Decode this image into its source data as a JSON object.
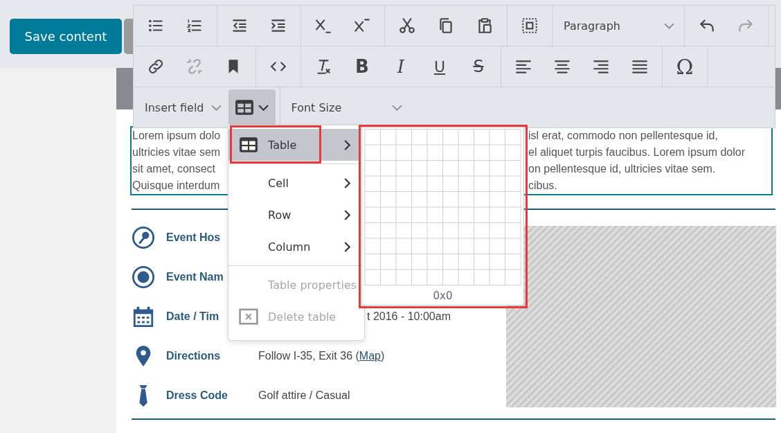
{
  "header": {
    "save_button": "Save content"
  },
  "toolbar": {
    "rows": [
      [
        {
          "buttons": [
            {
              "kind": "icon",
              "disabled": false
            },
            {
              "kind": "icon",
              "disabled": false
            }
          ]
        },
        {
          "buttons": [
            {
              "kind": "icon",
              "disabled": false
            },
            {
              "kind": "icon",
              "disabled": false
            }
          ]
        },
        {
          "buttons": [
            {
              "kind": "icon",
              "disabled": false
            },
            {
              "kind": "icon",
              "disabled": false
            }
          ]
        },
        {
          "buttons": [
            {
              "kind": "icon",
              "disabled": false
            },
            {
              "kind": "icon",
              "disabled": false
            },
            {
              "kind": "icon",
              "disabled": false
            }
          ]
        },
        {
          "buttons": [
            {
              "kind": "icon",
              "disabled": false
            }
          ]
        },
        {
          "buttons": [
            {
              "kind": "dropdown",
              "label": "Paragraph",
              "wide": true
            }
          ]
        },
        {
          "buttons": [
            {
              "kind": "icon",
              "disabled": false
            },
            {
              "kind": "icon",
              "disabled": true
            }
          ]
        }
      ],
      [
        {
          "buttons": [
            {
              "kind": "icon",
              "disabled": false
            },
            {
              "kind": "icon",
              "disabled": true
            },
            {
              "kind": "icon",
              "disabled": false
            }
          ]
        },
        {
          "buttons": [
            {
              "kind": "icon",
              "disabled": false
            }
          ]
        },
        {
          "buttons": [
            {
              "kind": "icon",
              "disabled": false
            },
            {
              "kind": "bold",
              "label": "B",
              "disabled": false
            },
            {
              "kind": "italic",
              "label": "I",
              "disabled": false
            },
            {
              "kind": "underline",
              "label": "U",
              "disabled": false
            },
            {
              "kind": "strike",
              "label": "S",
              "disabled": false
            }
          ]
        },
        {
          "buttons": [
            {
              "kind": "icon",
              "disabled": false
            },
            {
              "kind": "icon",
              "disabled": false
            },
            {
              "kind": "icon",
              "disabled": false
            },
            {
              "kind": "icon",
              "disabled": false
            }
          ]
        },
        {
          "buttons": [
            {
              "kind": "symbol",
              "label": "Ω",
              "disabled": false
            }
          ]
        }
      ],
      [
        {
          "buttons": [
            {
              "kind": "dropdown",
              "label": "Insert field",
              "wide": false
            },
            {
              "kind": "table",
              "selected": true
            }
          ]
        },
        {
          "buttons": [
            {
              "kind": "dropdown",
              "label": "Font Size",
              "wide": true
            }
          ]
        }
      ]
    ]
  },
  "editor": {
    "lines": [
      {
        "start": "Lorem ipsum dolo",
        "end": "isl erat, commodo non pellentesque id,"
      },
      {
        "start": "ultricies vitae sem",
        "end": "el aliquet turpis faucibus. Lorem ipsum dolor"
      },
      {
        "start": "sit amet, consect",
        "end": "on pellentesque id, ultricies vitae sem."
      },
      {
        "start": "Quisque interdum",
        "end": "cibus."
      }
    ]
  },
  "details": [
    {
      "label": "Event Hos"
    },
    {
      "label": "Event Nam"
    },
    {
      "label": "Date / Tim",
      "value": "t 2016 - 10:00am",
      "partly_hidden": true
    },
    {
      "label": "Directions",
      "value": "Follow I-35, Exit 36 (",
      "link": "Map",
      "value_after": ")",
      "partly_hidden": false
    },
    {
      "label": "Dress Code",
      "value": "Golf attire / Casual",
      "partly_hidden": false
    }
  ],
  "table_menu": {
    "items": [
      {
        "label": "Table",
        "selected": true,
        "submenu": true,
        "disabled": false,
        "separator_after": true
      },
      {
        "label": "Cell",
        "selected": false,
        "submenu": true,
        "disabled": false,
        "separator_after": false
      },
      {
        "label": "Row",
        "selected": false,
        "submenu": true,
        "disabled": false,
        "separator_after": false
      },
      {
        "label": "Column",
        "selected": false,
        "submenu": true,
        "disabled": false,
        "separator_after": true
      },
      {
        "label": "Table properties",
        "selected": false,
        "submenu": false,
        "disabled": true,
        "separator_after": false
      },
      {
        "label": "Delete table",
        "selected": false,
        "submenu": false,
        "disabled": true,
        "separator_after": false
      }
    ]
  },
  "grid_picker": {
    "size_label": "0x0"
  }
}
